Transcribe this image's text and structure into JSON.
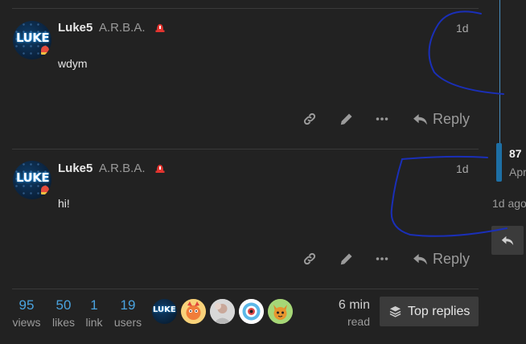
{
  "posts": [
    {
      "username": "Luke5",
      "user_title": "A.R.B.A.",
      "avatar_text": "LUKE",
      "date": "1d",
      "body": "wdym",
      "reply_label": "Reply"
    },
    {
      "username": "Luke5",
      "user_title": "A.R.B.A.",
      "avatar_text": "LUKE",
      "date": "1d",
      "body": "hi!",
      "reply_label": "Reply"
    }
  ],
  "stats": {
    "views": {
      "num": "95",
      "label": "views"
    },
    "likes": {
      "num": "50",
      "label": "likes"
    },
    "links": {
      "num": "1",
      "label": "link"
    },
    "users": {
      "num": "19",
      "label": "users"
    }
  },
  "participants": [
    "LUKE"
  ],
  "read_time": {
    "num": "6 min",
    "label": "read"
  },
  "top_replies_label": "Top replies",
  "timeline": {
    "count": "87",
    "date": "Apr",
    "ago": "1d ago"
  },
  "colors": {
    "background": "#222222",
    "accent": "#4aa3df",
    "timeline_handle": "#1d6fa5",
    "scribble": "#1a2fb8"
  },
  "icons": [
    "link-icon",
    "pencil-icon",
    "ellipsis-icon",
    "reply-icon",
    "layers-icon",
    "siren-icon"
  ]
}
